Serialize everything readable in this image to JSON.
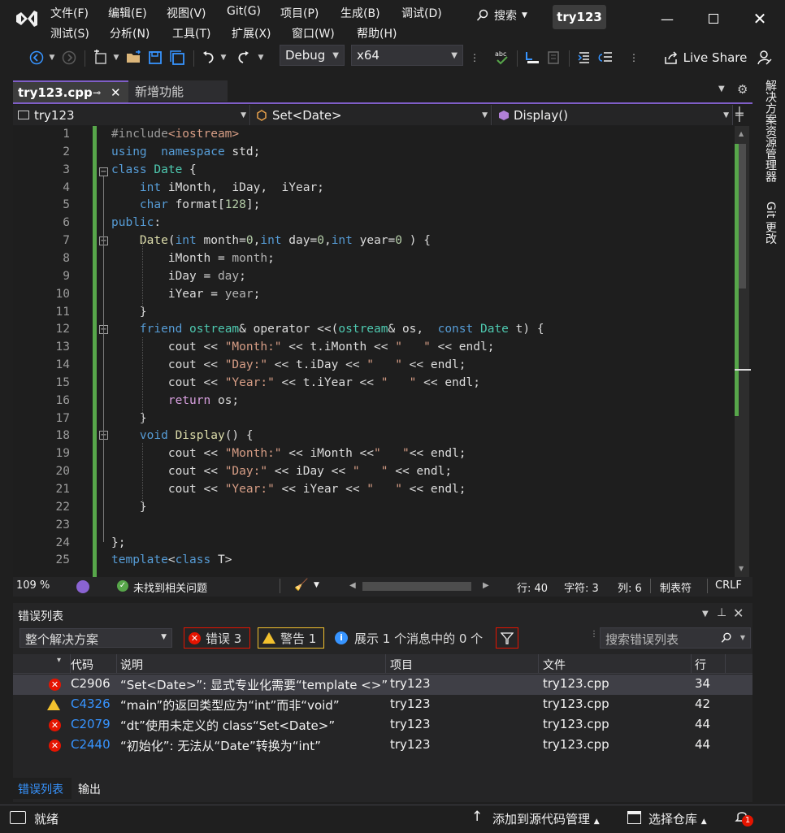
{
  "menu": {
    "row1": [
      "文件(F)",
      "编辑(E)",
      "视图(V)",
      "Git(G)",
      "项目(P)",
      "生成(B)",
      "调试(D)"
    ],
    "row2": [
      "测试(S)",
      "分析(N)",
      "工具(T)",
      "扩展(X)",
      "窗口(W)",
      "帮助(H)"
    ],
    "search_label": "搜索",
    "project_badge": "try123"
  },
  "toolbar": {
    "config": "Debug",
    "platform": "x64",
    "live_share": "Live Share"
  },
  "tabs": [
    {
      "label": "try123.cpp"
    },
    {
      "label": "新增功能"
    }
  ],
  "navbar": {
    "scope": "try123",
    "type": "Set<Date>",
    "member": "Display()"
  },
  "editor": {
    "line_numbers": [
      "1",
      "2",
      "3",
      "4",
      "5",
      "6",
      "7",
      "8",
      "9",
      "10",
      "11",
      "12",
      "13",
      "14",
      "15",
      "16",
      "17",
      "18",
      "19",
      "20",
      "21",
      "22",
      "23",
      "24",
      "25"
    ],
    "lines": [
      [
        [
          "pp",
          "#include"
        ],
        [
          "st",
          "<iostream>"
        ]
      ],
      [
        [
          "kw",
          "using"
        ],
        [
          "",
          "  "
        ],
        [
          "kw",
          "namespace"
        ],
        [
          "",
          " std;"
        ]
      ],
      [
        [
          "kw",
          "class"
        ],
        [
          "",
          " "
        ],
        [
          "ty",
          "Date"
        ],
        [
          "",
          " {"
        ]
      ],
      [
        [
          "",
          "    "
        ],
        [
          "kw",
          "int"
        ],
        [
          "",
          " iMonth,  iDay,  iYear;"
        ]
      ],
      [
        [
          "",
          "    "
        ],
        [
          "kw",
          "char"
        ],
        [
          "",
          " format["
        ],
        [
          "nm",
          "128"
        ],
        [
          "",
          "];"
        ]
      ],
      [
        [
          "kw",
          "public"
        ],
        [
          "",
          ":"
        ]
      ],
      [
        [
          "",
          "    "
        ],
        [
          "fn",
          "Date"
        ],
        [
          "",
          "("
        ],
        [
          "kw",
          "int"
        ],
        [
          "",
          " month="
        ],
        [
          "nm",
          "0"
        ],
        [
          "",
          ","
        ],
        [
          "kw",
          "int"
        ],
        [
          "",
          " day="
        ],
        [
          "nm",
          "0"
        ],
        [
          "",
          ","
        ],
        [
          "kw",
          "int"
        ],
        [
          "",
          " year="
        ],
        [
          "nm",
          "0"
        ],
        [
          "",
          " ) {"
        ]
      ],
      [
        [
          "",
          "        iMonth = "
        ],
        [
          "op",
          "month"
        ],
        [
          "",
          ";"
        ]
      ],
      [
        [
          "",
          "        iDay = "
        ],
        [
          "op",
          "day"
        ],
        [
          "",
          ";"
        ]
      ],
      [
        [
          "",
          "        iYear = "
        ],
        [
          "op",
          "year"
        ],
        [
          "",
          ";"
        ]
      ],
      [
        [
          "",
          "    }"
        ]
      ],
      [
        [
          "",
          "    "
        ],
        [
          "kw",
          "friend"
        ],
        [
          "",
          " "
        ],
        [
          "ty",
          "ostream"
        ],
        [
          "",
          "& operator <<("
        ],
        [
          "ty",
          "ostream"
        ],
        [
          "",
          "& os,  "
        ],
        [
          "kw",
          "const"
        ],
        [
          "",
          " "
        ],
        [
          "ty",
          "Date"
        ],
        [
          "",
          " t) {"
        ]
      ],
      [
        [
          "",
          "        cout << "
        ],
        [
          "st",
          "\"Month:\""
        ],
        [
          "",
          " << t.iMonth << "
        ],
        [
          "st",
          "\"   \""
        ],
        [
          "",
          " << endl;"
        ]
      ],
      [
        [
          "",
          "        cout << "
        ],
        [
          "st",
          "\"Day:\""
        ],
        [
          "",
          " << t.iDay << "
        ],
        [
          "st",
          "\"   \""
        ],
        [
          "",
          " << endl;"
        ]
      ],
      [
        [
          "",
          "        cout << "
        ],
        [
          "st",
          "\"Year:\""
        ],
        [
          "",
          " << t.iYear << "
        ],
        [
          "st",
          "\"   \""
        ],
        [
          "",
          " << endl;"
        ]
      ],
      [
        [
          "",
          "        "
        ],
        [
          "ctl",
          "return"
        ],
        [
          "",
          " os;"
        ]
      ],
      [
        [
          "",
          "    }"
        ]
      ],
      [
        [
          "",
          "    "
        ],
        [
          "kw",
          "void"
        ],
        [
          "",
          " "
        ],
        [
          "fn",
          "Display"
        ],
        [
          "",
          "() {"
        ]
      ],
      [
        [
          "",
          "        cout << "
        ],
        [
          "st",
          "\"Month:\""
        ],
        [
          "",
          " << iMonth <<"
        ],
        [
          "st",
          "\"   \""
        ],
        [
          "",
          "<< endl;"
        ]
      ],
      [
        [
          "",
          "        cout << "
        ],
        [
          "st",
          "\"Day:\""
        ],
        [
          "",
          " << iDay << "
        ],
        [
          "st",
          "\"   \""
        ],
        [
          "",
          " << endl;"
        ]
      ],
      [
        [
          "",
          "        cout << "
        ],
        [
          "st",
          "\"Year:\""
        ],
        [
          "",
          " << iYear << "
        ],
        [
          "st",
          "\"   \""
        ],
        [
          "",
          " << endl;"
        ]
      ],
      [
        [
          "",
          "    }"
        ]
      ],
      [
        [
          "",
          ""
        ]
      ],
      [
        [
          "",
          "};"
        ]
      ],
      [
        [
          "kw",
          "template"
        ],
        [
          "",
          "<"
        ],
        [
          "kw",
          "class"
        ],
        [
          "",
          " T>"
        ]
      ]
    ]
  },
  "status": {
    "zoom": "109 %",
    "issues": "未找到相关问题",
    "line": "行: 40",
    "col_char": "字符: 3",
    "col": "列: 6",
    "tabs_mode": "制表符",
    "eol": "CRLF"
  },
  "errorlist": {
    "title": "错误列表",
    "scope": "整个解决方案",
    "errors_btn": "错误 3",
    "warnings_btn": "警告 1",
    "messages_btn": "展示 1 个消息中的 0 个",
    "search_placeholder": "搜索错误列表",
    "columns": [
      "代码",
      "说明",
      "项目",
      "文件",
      "行"
    ],
    "rows": [
      {
        "kind": "error",
        "code": "C2906",
        "desc": "“Set<Date>”: 显式专业化需要“template <>”",
        "project": "try123",
        "file": "try123.cpp",
        "line": "34"
      },
      {
        "kind": "warning",
        "code": "C4326",
        "desc": "“main”的返回类型应为“int”而非“void”",
        "project": "try123",
        "file": "try123.cpp",
        "line": "42"
      },
      {
        "kind": "error",
        "code": "C2079",
        "desc": "“dt”使用未定义的 class“Set<Date>”",
        "project": "try123",
        "file": "try123.cpp",
        "line": "44"
      },
      {
        "kind": "error",
        "code": "C2440",
        "desc": "“初始化”: 无法从“Date”转换为“int”",
        "project": "try123",
        "file": "try123.cpp",
        "line": "44"
      }
    ]
  },
  "bottom_tabs": [
    "错误列表",
    "输出"
  ],
  "statusbar": {
    "ready": "就绪",
    "source_control": "添加到源代码管理",
    "repo": "选择仓库",
    "notif_count": "1"
  },
  "sidebar": {
    "solution_explorer": "解决方案资源管理器",
    "git_changes": "Git 更改"
  }
}
